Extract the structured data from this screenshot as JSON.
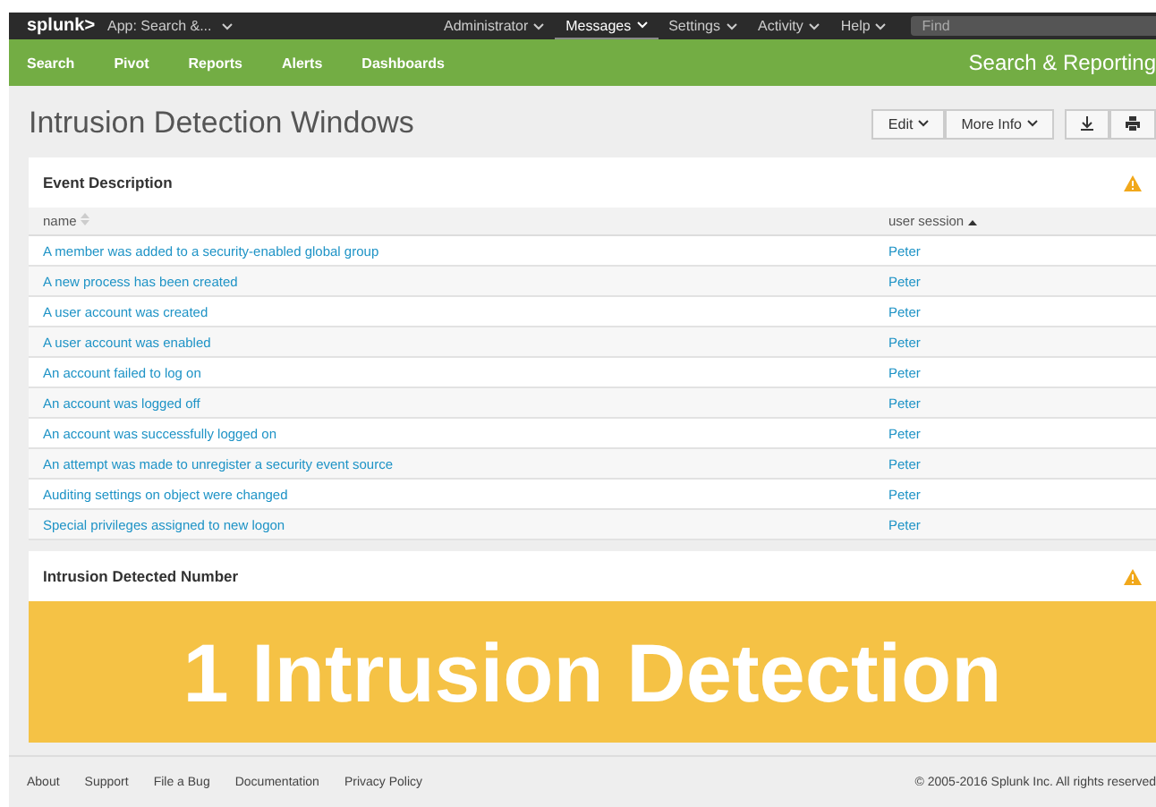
{
  "top_bar": {
    "logo": "splunk>",
    "app_menu": "App: Search &...",
    "menus": [
      {
        "label": "Administrator",
        "selected": false
      },
      {
        "label": "Messages",
        "selected": true
      },
      {
        "label": "Settings",
        "selected": false
      },
      {
        "label": "Activity",
        "selected": false
      },
      {
        "label": "Help",
        "selected": false
      }
    ],
    "search": {
      "placeholder": "Find"
    }
  },
  "app_bar": {
    "items": [
      "Search",
      "Pivot",
      "Reports",
      "Alerts",
      "Dashboards"
    ],
    "app_title": "Search & Reporting"
  },
  "dashboard": {
    "title": "Intrusion Detection Windows",
    "buttons": [
      "Edit",
      "More Info"
    ]
  },
  "event_panel": {
    "title": "Event Description",
    "columns": [
      {
        "label": "name",
        "sorted": false
      },
      {
        "label": "user session",
        "sorted": true
      }
    ],
    "rows": [
      [
        "A member was added to a security-enabled global group",
        "Peter"
      ],
      [
        "A new process has been created",
        "Peter"
      ],
      [
        "A user account was created",
        "Peter"
      ],
      [
        "A user account was enabled",
        "Peter"
      ],
      [
        "An account failed to log on",
        "Peter"
      ],
      [
        "An account was logged off",
        "Peter"
      ],
      [
        "An account was successfully logged on",
        "Peter"
      ],
      [
        "An attempt was made to unregister a security event source",
        "Peter"
      ],
      [
        "Auditing settings on object were changed",
        "Peter"
      ],
      [
        "Special privileges assigned to new logon",
        "Peter"
      ]
    ]
  },
  "number_panel": {
    "title": "Intrusion Detected Number",
    "value": "1 Intrusion Detection",
    "color": "#f5c245"
  },
  "footer": {
    "links": [
      "About",
      "Support",
      "File a Bug",
      "Documentation",
      "Privacy Policy"
    ],
    "copyright": "© 2005-2016 Splunk Inc. All rights reserved"
  }
}
